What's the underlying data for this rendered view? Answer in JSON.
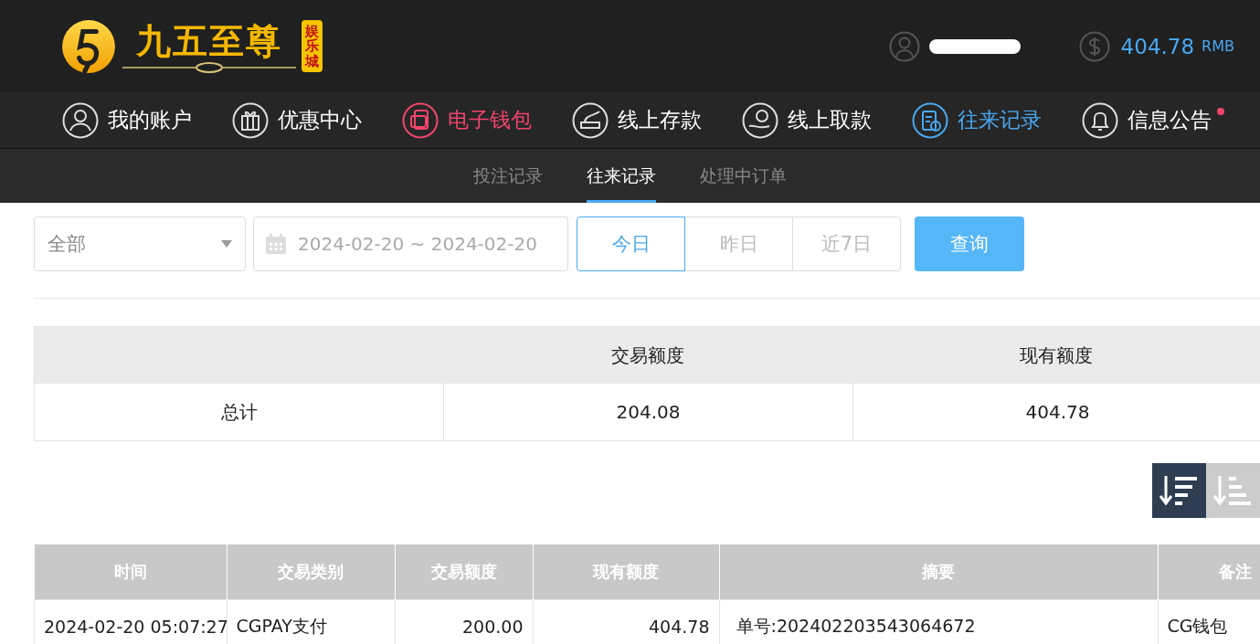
{
  "header": {
    "logo": {
      "name": "九五至尊",
      "badge": "娱乐城"
    },
    "username_redacted": true,
    "balance": "404.78",
    "currency": "RMB"
  },
  "nav": [
    {
      "label": "我的账户",
      "selected": false,
      "highlighted": false,
      "dot": false
    },
    {
      "label": "优惠中心",
      "selected": false,
      "highlighted": false,
      "dot": false
    },
    {
      "label": "电子钱包",
      "selected": false,
      "highlighted": true,
      "dot": false
    },
    {
      "label": "线上存款",
      "selected": false,
      "highlighted": false,
      "dot": false
    },
    {
      "label": "线上取款",
      "selected": false,
      "highlighted": false,
      "dot": false
    },
    {
      "label": "往来记录",
      "selected": true,
      "highlighted": false,
      "dot": false
    },
    {
      "label": "信息公告",
      "selected": false,
      "highlighted": false,
      "dot": true
    }
  ],
  "subtabs": [
    {
      "label": "投注记录",
      "selected": false
    },
    {
      "label": "往来记录",
      "selected": true
    },
    {
      "label": "处理中订单",
      "selected": false
    }
  ],
  "filters": {
    "type_select": "全部",
    "date_range": "2024-02-20 ~ 2024-02-20",
    "quick_dates": [
      {
        "label": "今日",
        "selected": true
      },
      {
        "label": "昨日",
        "selected": false
      },
      {
        "label": "近7日",
        "selected": false
      }
    ],
    "query_button": "查询"
  },
  "summary": {
    "columns": [
      "交易额度",
      "现有额度"
    ],
    "row": [
      "总计",
      "204.08",
      "404.78"
    ]
  },
  "sort_buttons": [
    {
      "selected": true
    },
    {
      "selected": false
    }
  ],
  "table": {
    "columns": [
      "时间",
      "交易类别",
      "交易额度",
      "现有额度",
      "摘要",
      "备注"
    ],
    "rows": [
      [
        "2024-02-20 05:07:27",
        "CGPAY支付",
        "200.00",
        "404.78",
        "单号:202402203543064672",
        "CG钱包"
      ]
    ]
  }
}
